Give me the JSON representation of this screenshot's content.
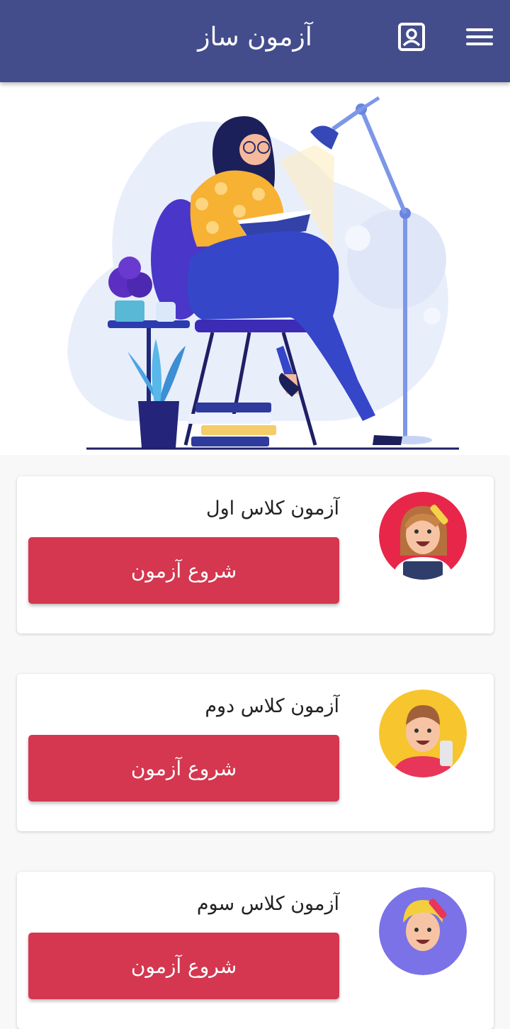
{
  "header": {
    "title": "آزمون ساز",
    "menu_icon": "hamburger-menu-icon",
    "profile_icon": "profile-card-icon",
    "background_color": "#434d8c"
  },
  "hero": {
    "illustration": "woman-reading-book-illustration"
  },
  "exams": [
    {
      "title": "آزمون کلاس اول",
      "button_label": "شروع آزمون",
      "avatar": "female-student-avatar",
      "avatar_bg": "#e8264a"
    },
    {
      "title": "آزمون کلاس دوم",
      "button_label": "شروع آزمون",
      "avatar": "male-student-avatar",
      "avatar_bg": "#f7c52d"
    },
    {
      "title": "آزمون کلاس سوم",
      "button_label": "شروع آزمون",
      "avatar": "blonde-student-avatar",
      "avatar_bg": "#7a72e6"
    }
  ],
  "colors": {
    "accent_button": "#d4374f",
    "page_background": "#f8f8f8"
  }
}
